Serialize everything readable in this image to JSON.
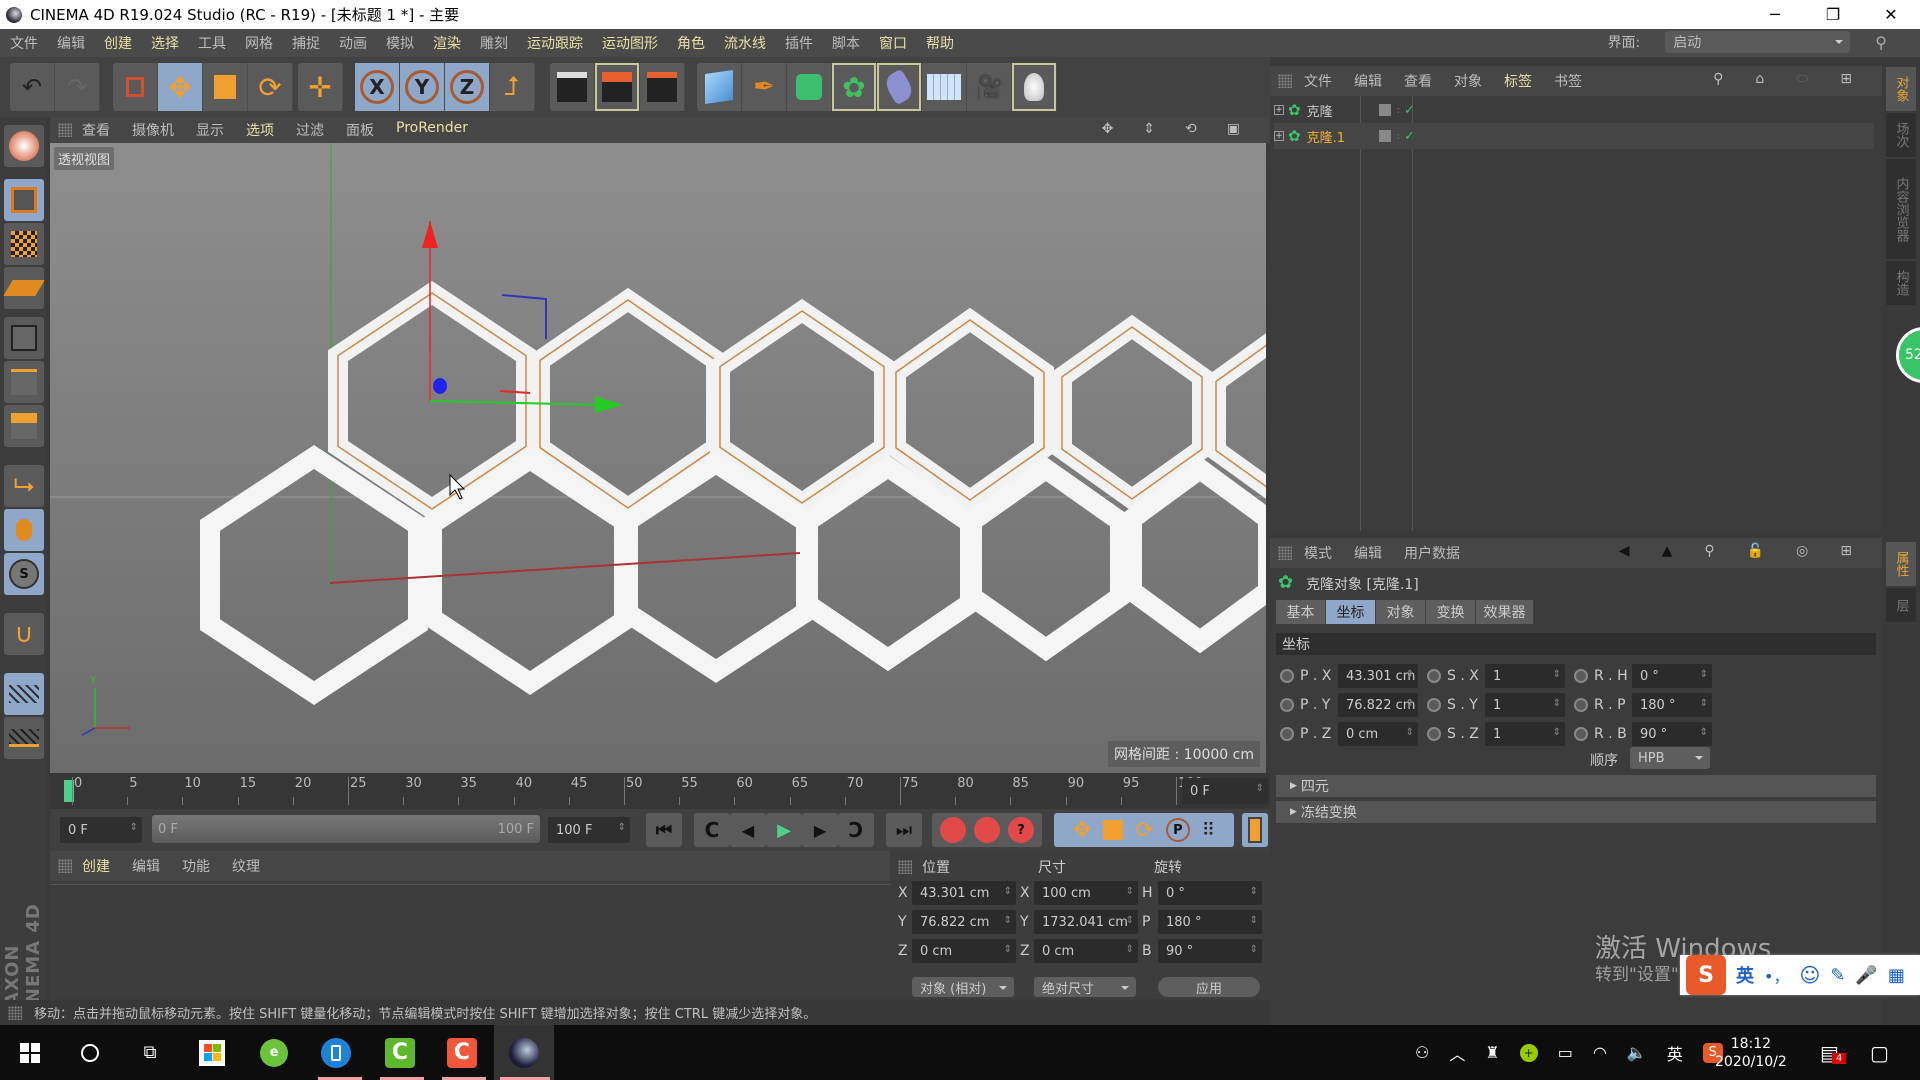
{
  "window": {
    "title": "CINEMA 4D R19.024 Studio (RC - R19) - [未标题 1 *] - 主要",
    "controls": {
      "minimize": "─",
      "maximize": "❐",
      "close": "✕"
    }
  },
  "menubar": {
    "items": [
      {
        "label": "文件",
        "hl": false
      },
      {
        "label": "编辑",
        "hl": false
      },
      {
        "label": "创建",
        "hl": true
      },
      {
        "label": "选择",
        "hl": true
      },
      {
        "label": "工具",
        "hl": false
      },
      {
        "label": "网格",
        "hl": false
      },
      {
        "label": "捕捉",
        "hl": false
      },
      {
        "label": "动画",
        "hl": false
      },
      {
        "label": "模拟",
        "hl": false
      },
      {
        "label": "渲染",
        "hl": true
      },
      {
        "label": "雕刻",
        "hl": false
      },
      {
        "label": "运动跟踪",
        "hl": true
      },
      {
        "label": "运动图形",
        "hl": true
      },
      {
        "label": "角色",
        "hl": true
      },
      {
        "label": "流水线",
        "hl": true
      },
      {
        "label": "插件",
        "hl": false
      },
      {
        "label": "脚本",
        "hl": false
      },
      {
        "label": "窗口",
        "hl": true
      },
      {
        "label": "帮助",
        "hl": true
      }
    ],
    "interface_label": "界面:",
    "interface_value": "启动"
  },
  "toolbar": {
    "buttons": [
      "undo",
      "redo",
      "live-selection",
      "move",
      "scale",
      "rotate",
      "move-alt",
      "lock-x",
      "lock-y",
      "lock-z",
      "world-coordinates",
      "render-view",
      "render-picture-viewer",
      "render-settings",
      "cube",
      "pen",
      "subdivision",
      "array",
      "deformer",
      "floor",
      "camera",
      "light"
    ]
  },
  "left_tools": [
    "model-mode",
    "object-mode",
    "texture-mode",
    "workplane-mode",
    "points-mode",
    "edges-mode",
    "polygons-mode",
    "axis-mode",
    "tweak-mode",
    "solo-mode",
    "snap",
    "workplane-lock",
    "workplane-align"
  ],
  "viewport": {
    "menu": [
      {
        "label": "查看",
        "hl": false
      },
      {
        "label": "摄像机",
        "hl": false
      },
      {
        "label": "显示",
        "hl": false
      },
      {
        "label": "选项",
        "hl": true
      },
      {
        "label": "过滤",
        "hl": false
      },
      {
        "label": "面板",
        "hl": false
      },
      {
        "label": "ProRender",
        "hl": true
      }
    ],
    "label": "透视视图",
    "grid_spacing": "网格间距 : 10000 cm"
  },
  "timeline": {
    "ticks": [
      "0",
      "5",
      "10",
      "15",
      "20",
      "25",
      "30",
      "35",
      "40",
      "45",
      "50",
      "55",
      "60",
      "65",
      "70",
      "75",
      "80",
      "85",
      "90",
      "95",
      "100"
    ],
    "current_frame": "0 F"
  },
  "transport": {
    "start_field": "0 F",
    "range_start": "0 F",
    "range_end": "100 F",
    "end_field": "100 F"
  },
  "material_manager": {
    "menu": [
      "创建",
      "编辑",
      "功能",
      "纹理"
    ]
  },
  "coord_manager": {
    "headers": {
      "position": "位置",
      "size": "尺寸",
      "rotation": "旋转"
    },
    "rows": [
      {
        "pos_axis": "X",
        "pos": "43.301 cm",
        "size_axis": "X",
        "size": "100 cm",
        "rot_axis": "H",
        "rot": "0 °"
      },
      {
        "pos_axis": "Y",
        "pos": "76.822 cm",
        "size_axis": "Y",
        "size": "1732.041 cm",
        "rot_axis": "P",
        "rot": "180 °"
      },
      {
        "pos_axis": "Z",
        "pos": "0 cm",
        "size_axis": "Z",
        "size": "0 cm",
        "rot_axis": "B",
        "rot": "90 °"
      }
    ],
    "mode_select": "对象 (相对)",
    "size_select": "绝对尺寸",
    "apply": "应用"
  },
  "status": "移动：点击并拖动鼠标移动元素。按住 SHIFT 键量化移动；节点编辑模式时按住 SHIFT 键增加选择对象；按住 CTRL 键减少选择对象。",
  "object_manager": {
    "menu": [
      {
        "label": "文件",
        "hl": false
      },
      {
        "label": "编辑",
        "hl": false
      },
      {
        "label": "查看",
        "hl": false
      },
      {
        "label": "对象",
        "hl": false
      },
      {
        "label": "标签",
        "hl": true
      },
      {
        "label": "书签",
        "hl": false
      }
    ],
    "objects": [
      {
        "name": "克隆",
        "selected": false
      },
      {
        "name": "克隆.1",
        "selected": true
      }
    ]
  },
  "attribute_manager": {
    "menu": [
      "模式",
      "编辑",
      "用户数据"
    ],
    "object_title": "克隆对象 [克隆.1]",
    "tabs": [
      {
        "label": "基本",
        "sel": false
      },
      {
        "label": "坐标",
        "sel": true
      },
      {
        "label": "对象",
        "sel": false
      },
      {
        "label": "变换",
        "sel": false
      },
      {
        "label": "效果器",
        "sel": false
      }
    ],
    "section": "坐标",
    "fields": [
      {
        "p_label": "P . X",
        "p": "43.301 cm",
        "s_label": "S . X",
        "s": "1",
        "r_label": "R . H",
        "r": "0 °"
      },
      {
        "p_label": "P . Y",
        "p": "76.822 cm",
        "s_label": "S . Y",
        "s": "1",
        "r_label": "R . P",
        "r": "180 °"
      },
      {
        "p_label": "P . Z",
        "p": "0 cm",
        "s_label": "S . Z",
        "s": "1",
        "r_label": "R . B",
        "r": "90 °"
      }
    ],
    "order_label": "顺序",
    "order_value": "HPB",
    "collapsed": [
      "四元",
      "冻结变换"
    ]
  },
  "side_tabs": {
    "top": [
      {
        "label": "对象",
        "sel": true
      },
      {
        "label": "场次",
        "sel": false
      },
      {
        "label": "内容浏览器",
        "sel": false
      },
      {
        "label": "构造",
        "sel": false
      }
    ],
    "bottom": [
      {
        "label": "属性",
        "sel": true
      },
      {
        "label": "层",
        "sel": false
      }
    ],
    "badge": "52"
  },
  "watermark": {
    "line1": "激活 Windows",
    "line2": "转到\"设置\"以激活 Windows。"
  },
  "ime": {
    "lang": "英",
    "punct": "•，"
  },
  "taskbar": {
    "apps": [
      "start",
      "search",
      "task-view",
      "store",
      "browser",
      "phone",
      "camtasia-green",
      "camtasia-red",
      "cinema4d"
    ],
    "tray_lang": "英",
    "time": "18:12",
    "date": "2020/10/2",
    "notifications": "4"
  },
  "colors": {
    "accent_select": "#8fa7c9",
    "highlight_text": "#e8e0a6",
    "orange": "#f0a030",
    "clone_green": "#39c46a"
  }
}
